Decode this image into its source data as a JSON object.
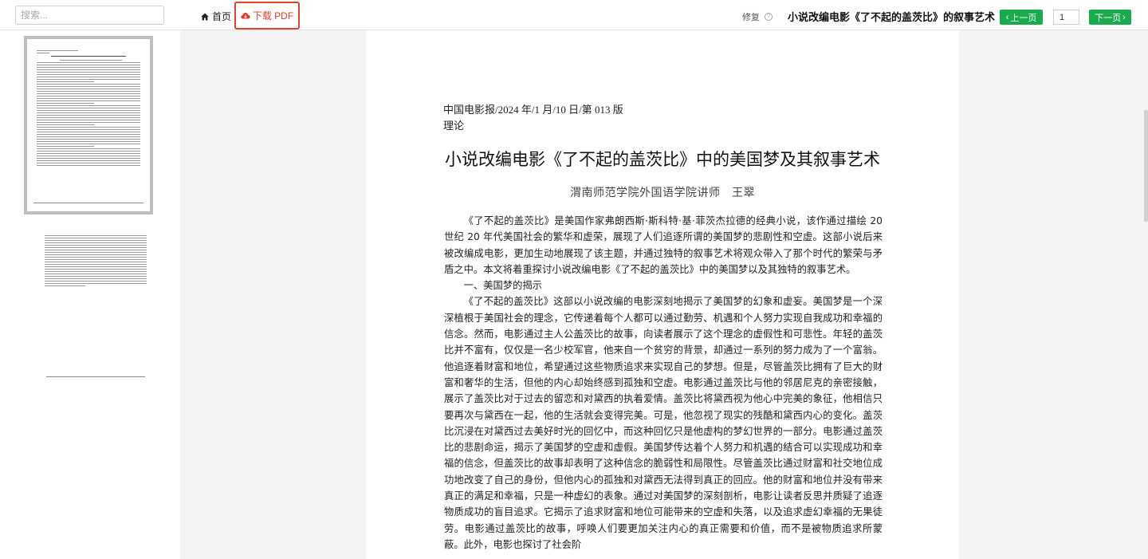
{
  "search": {
    "placeholder": "搜索..."
  },
  "nav": {
    "home_label": "首页",
    "download_label": "下载 PDF",
    "repair_label": "修复",
    "repair_help": "?",
    "doc_title": "小说改编电影《了不起的盖茨比》的叙事艺术",
    "prev_label": "上一页",
    "next_label": "下一页",
    "page_value": "1"
  },
  "colors": {
    "accent_green": "#1aab4c",
    "download_red": "#e23b2a"
  },
  "document": {
    "source_line": "中国电影报/2024 年/1 月/10 日/第 013 版",
    "column": "理论",
    "title": "小说改编电影《了不起的盖茨比》中的美国梦及其叙事艺术",
    "author": "渭南师范学院外国语学院讲师　王翠",
    "paragraphs": [
      "《了不起的盖茨比》是美国作家弗朗西斯·斯科特·基·菲茨杰拉德的经典小说，该作通过描绘 20 世纪 20 年代美国社会的繁华和虚荣，展现了人们追逐所谓的美国梦的悲剧性和空虚。这部小说后来被改编成电影，更加生动地展现了该主题，并通过独特的叙事艺术将观众带入了那个时代的繁荣与矛盾之中。本文将着重探讨小说改编电影《了不起的盖茨比》中的美国梦以及其独特的叙事艺术。",
      "一、美国梦的揭示",
      "《了不起的盖茨比》这部以小说改编的电影深刻地揭示了美国梦的幻象和虚妄。美国梦是一个深深植根于美国社会的理念，它传递着每个人都可以通过勤劳、机遇和个人努力实现自我成功和幸福的信念。然而，电影通过主人公盖茨比的故事，向读者展示了这个理念的虚假性和可悲性。年轻的盖茨比并不富有，仅仅是一名少校军官，他来自一个贫穷的背景，却通过一系列的努力成为了一个富翁。他追逐着财富和地位，希望通过这些物质追求来实现自己的梦想。但是，尽管盖茨比拥有了巨大的财富和奢华的生活，但他的内心却始终感到孤独和空虚。电影通过盖茨比与他的邻居尼克的亲密接触，展示了盖茨比对于过去的留恋和对黛西的执着爱情。盖茨比将黛西视为他心中完美的象征，他相信只要再次与黛西在一起，他的生活就会变得完美。可是，他忽视了现实的残酷和黛西内心的变化。盖茨比沉浸在对黛西过去美好时光的回忆中，而这种回忆只是他虚构的梦幻世界的一部分。电影通过盖茨比的悲剧命运，揭示了美国梦的空虚和虚假。美国梦传达着个人努力和机遇的结合可以实现成功和幸福的信念，但盖茨比的故事却表明了这种信念的脆弱性和局限性。尽管盖茨比通过财富和社交地位成功地改变了自己的身份，但他内心的孤独和对黛西无法得到真正的回应。他的财富和地位并没有带来真正的满足和幸福，只是一种虚幻的表象。通过对美国梦的深刻剖析，电影让读者反思并质疑了追逐物质成功的盲目追求。它揭示了追求财富和地位可能带来的空虚和失落，以及追求虚幻幸福的无果徒劳。电影通过盖茨比的故事，呼唤人们要更加关注内心的真正需要和价值，而不是被物质追求所蒙蔽。此外，电影也探讨了社会阶"
    ]
  }
}
